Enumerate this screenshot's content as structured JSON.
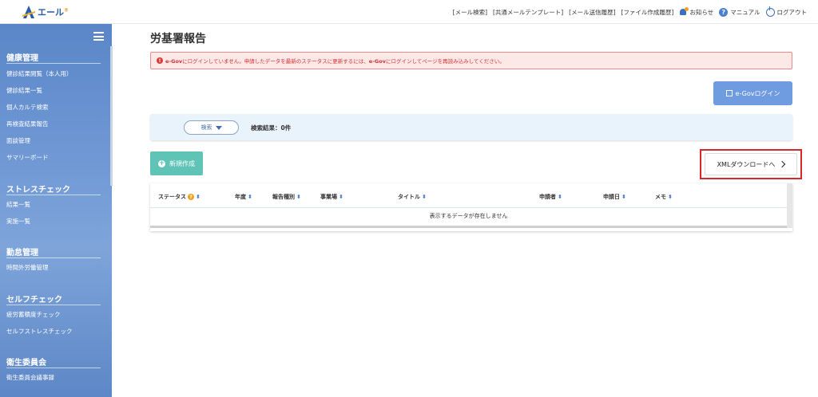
{
  "app": {
    "logo_text": "エール",
    "logo_mark": "®"
  },
  "topnav": {
    "mail_search": "[メール検索]",
    "mail_template": "[共通メールテンプレート]",
    "mail_history": "[メール送信履歴]",
    "file_history": "[ファイル作成履歴]",
    "notice": "お知らせ",
    "manual": "マニュアル",
    "logout": "ログアウト"
  },
  "sidebar": {
    "sections": [
      {
        "title": "健康管理",
        "items": [
          "健診結果閲覧（本人用）",
          "健診結果一覧",
          "個人カルテ検索",
          "再検査結果報告",
          "面談管理",
          "サマリーボード"
        ]
      },
      {
        "title": "ストレスチェック",
        "items": [
          "結果一覧",
          "実施一覧"
        ]
      },
      {
        "title": "勤怠管理",
        "items": [
          "時間外労働管理"
        ]
      },
      {
        "title": "セルフチェック",
        "items": [
          "疲労蓄積度チェック",
          "セルフストレスチェック"
        ]
      },
      {
        "title": "衛生委員会",
        "items": [
          "衛生委員会議事録"
        ]
      }
    ]
  },
  "main": {
    "title": "労基署報告",
    "alert": {
      "icon": "!",
      "text_parts": [
        "e-Gov",
        "にログインしていません。申請したデータを最新のステータスに更新するには、",
        "e-Gov",
        "にログインしてページを再読み込みしてください。"
      ]
    },
    "egov_login": "e-Govログイン",
    "search_toggle": "検索",
    "result_count": "検索結果：0件",
    "new_button": "新規作成",
    "xml_button": "XMLダウンロードへ",
    "table": {
      "columns": [
        "ステータス",
        "年度",
        "報告種別",
        "事業場",
        "タイトル",
        "申請者",
        "申請日",
        "メモ"
      ],
      "empty_text": "表示するデータが存在しません"
    }
  },
  "colors": {
    "sidebar": "#6f98d4",
    "alert_bg": "#fde8e8",
    "alert_text": "#d23030",
    "primary": "#6f9be0",
    "new_button": "#5fc4b6",
    "highlight_border": "#d8262a"
  }
}
